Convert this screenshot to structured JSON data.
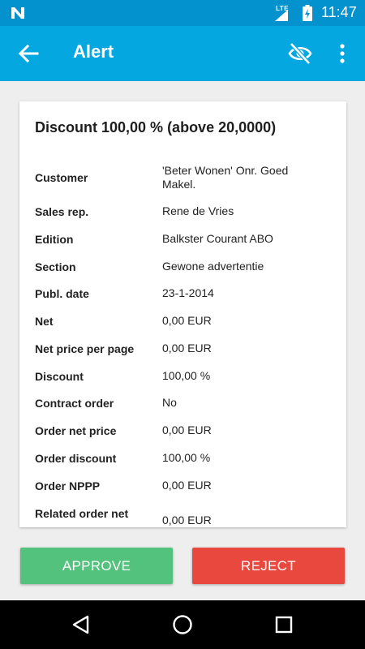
{
  "status_bar": {
    "network": "LTE",
    "time": "11:47",
    "icons": [
      "notification-n-icon",
      "signal-icon",
      "battery-charging-icon"
    ]
  },
  "app_bar": {
    "title": "Alert",
    "icons": [
      "back-arrow-icon",
      "eye-off-icon",
      "more-vert-icon"
    ]
  },
  "card": {
    "heading": "Discount 100,00 % (above 20,0000)",
    "fields": [
      {
        "label": "Customer",
        "value": "'Beter Wonen' Onr. Goed Makel."
      },
      {
        "label": "Sales rep.",
        "value": "Rene de Vries"
      },
      {
        "label": "Edition",
        "value": "Balkster Courant ABO"
      },
      {
        "label": "Section",
        "value": "Gewone advertentie"
      },
      {
        "label": "Publ. date",
        "value": "23-1-2014"
      },
      {
        "label": "Net",
        "value": "0,00 EUR"
      },
      {
        "label": "Net price per page",
        "value": "0,00 EUR"
      },
      {
        "label": "Discount",
        "value": "100,00 %"
      },
      {
        "label": "Contract order",
        "value": "No"
      },
      {
        "label": "Order net price",
        "value": "0,00 EUR"
      },
      {
        "label": "Order discount",
        "value": "100,00 %"
      },
      {
        "label": "Order NPPP",
        "value": "0,00 EUR"
      },
      {
        "label": "Related order net",
        "value": "0,00 EUR"
      }
    ]
  },
  "actions": {
    "approve_label": "APPROVE",
    "reject_label": "REJECT",
    "approve_color": "#53c27d",
    "reject_color": "#e8483e"
  },
  "colors": {
    "app_bar": "#04a7e0",
    "status_bar": "#0492cf"
  },
  "nav_bar": {
    "icons": [
      "back-triangle-icon",
      "home-circle-icon",
      "recents-square-icon"
    ]
  }
}
